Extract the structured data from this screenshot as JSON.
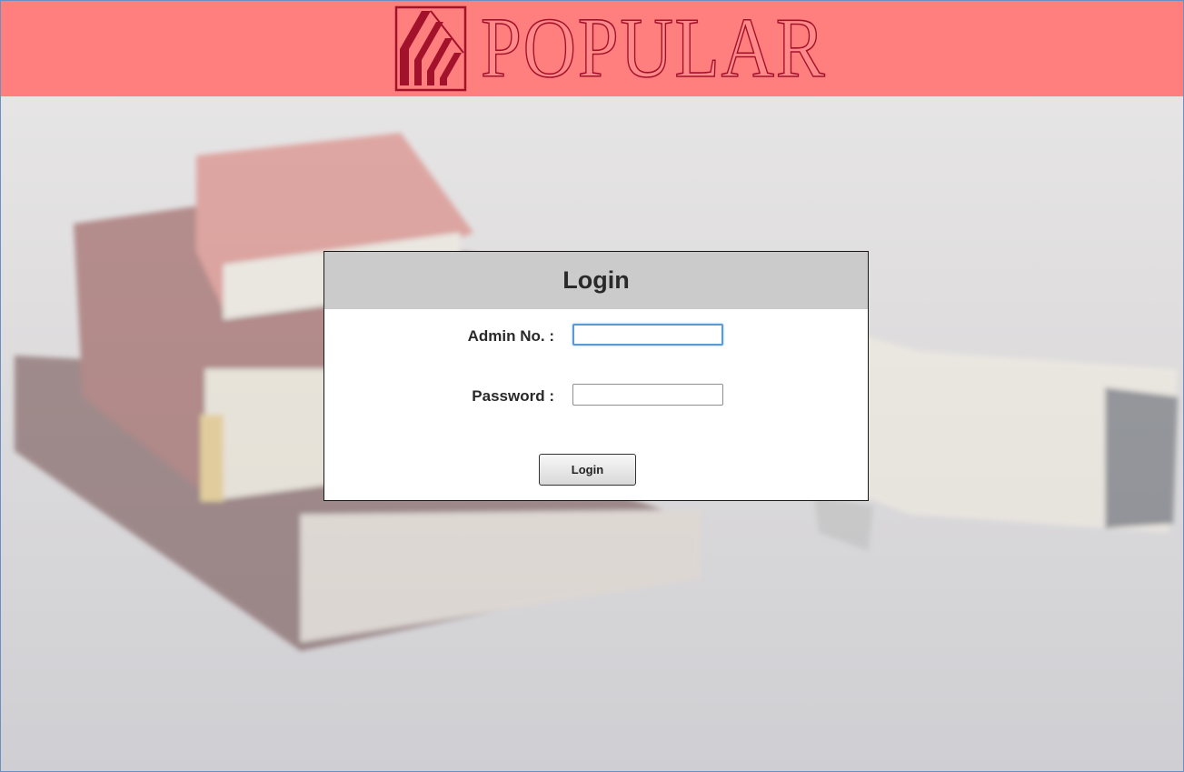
{
  "header": {
    "brand_name": "POPULAR",
    "brand_color": "#ff7f7e",
    "logo_color": "#a3122b"
  },
  "login": {
    "title": "Login",
    "admin_no_label": "Admin No. :",
    "admin_no_value": "",
    "password_label": "Password :",
    "password_value": "",
    "button_label": "Login"
  }
}
